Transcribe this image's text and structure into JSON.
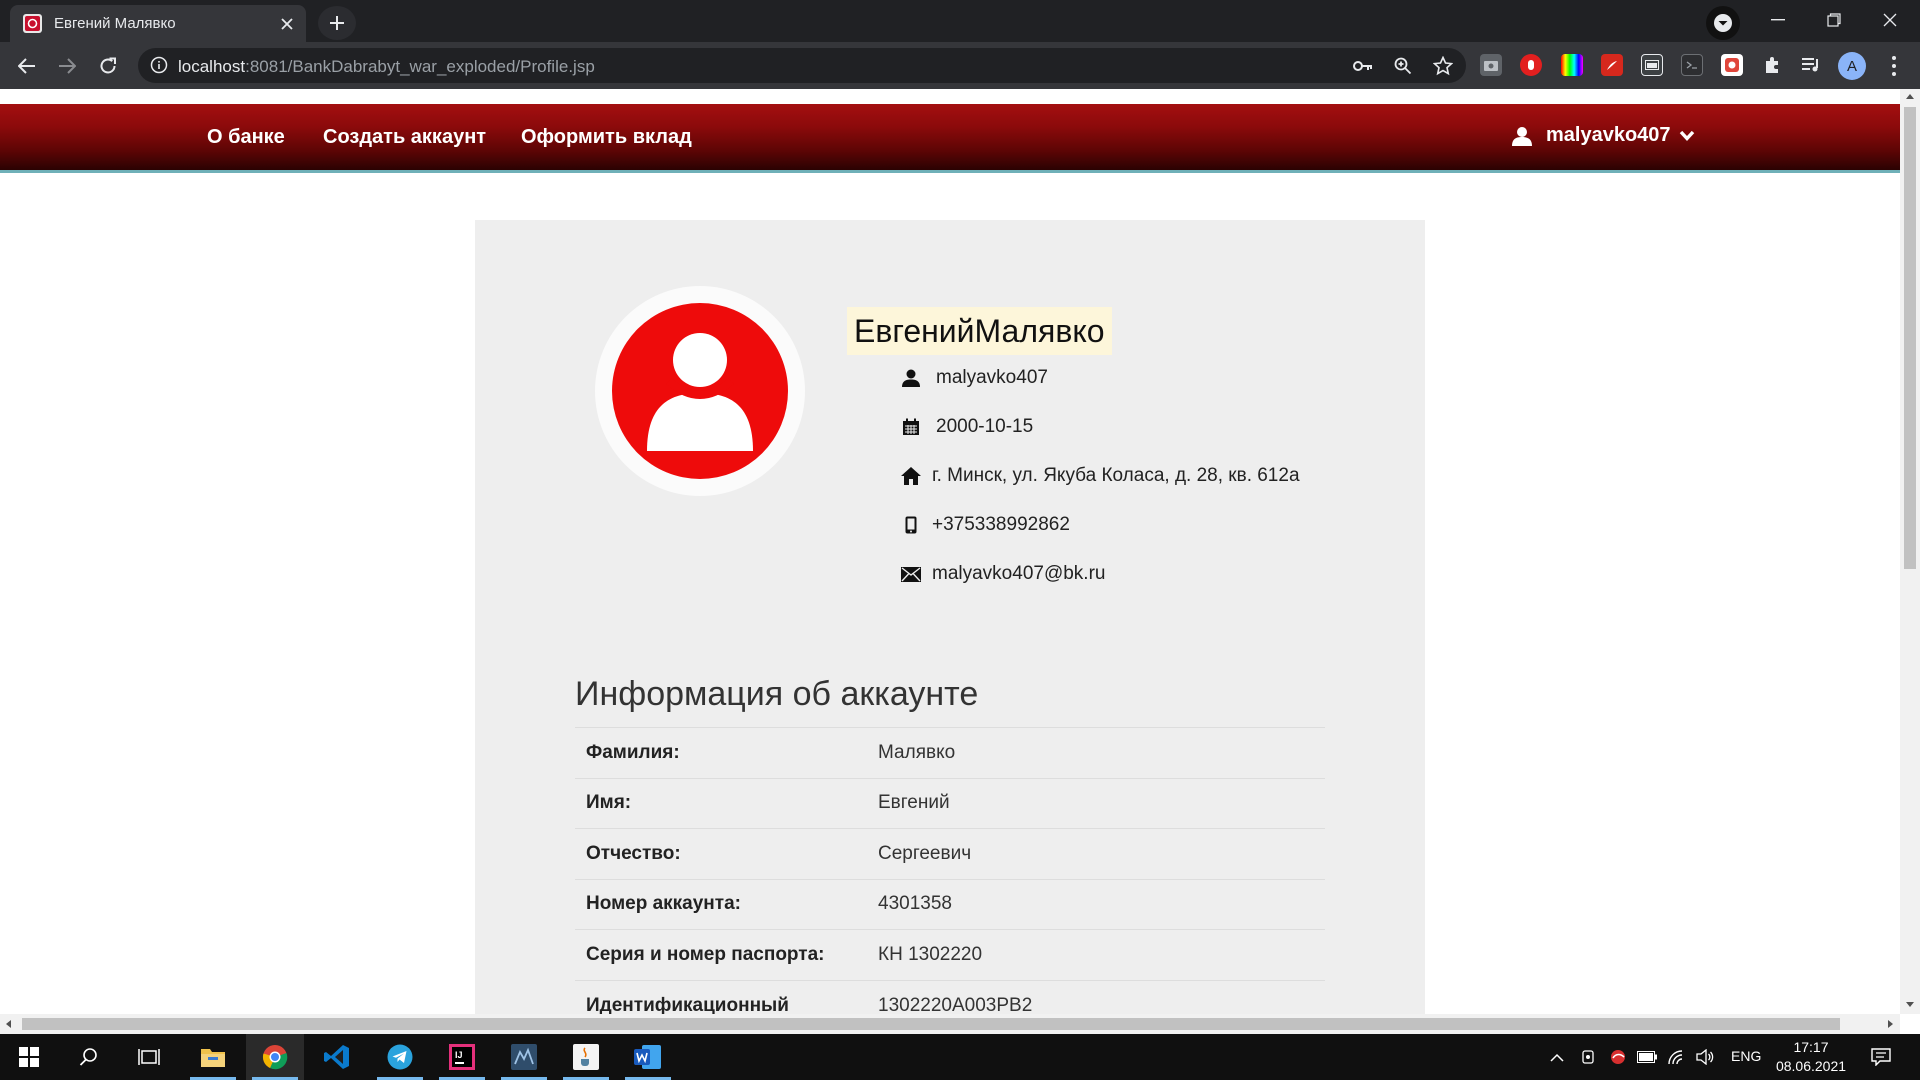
{
  "browser": {
    "tab_title": "Евгений Малявко",
    "url_host": "localhost",
    "url_rest": ":8081/BankDabrabyt_war_exploded/Profile.jsp",
    "avatar_letter": "A"
  },
  "site": {
    "nav": {
      "about": "О банке",
      "create_account": "Создать аккаунт",
      "make_deposit": "Оформить вклад",
      "username": "malyavko407"
    },
    "brand_color": "#8b0a0b"
  },
  "profile": {
    "full_name": "ЕвгенийМалявко",
    "username": "malyavko407",
    "birth_date": "2000-10-15",
    "address": "г. Минск, ул. Якуба Коласа, д. 28, кв. 612a",
    "phone": "+375338992862",
    "email": "malyavko407@bk.ru"
  },
  "account_info": {
    "title": "Информация об аккаунте",
    "rows": [
      {
        "label": "Фамилия:",
        "value": "Малявко"
      },
      {
        "label": "Имя:",
        "value": "Евгений"
      },
      {
        "label": "Отчество:",
        "value": "Сергеевич"
      },
      {
        "label": "Номер аккаунта:",
        "value": "4301358"
      },
      {
        "label": "Серия и номер паспорта:",
        "value": "КН 1302220"
      },
      {
        "label": "Идентификационный",
        "value": "1302220A003PB2"
      }
    ]
  },
  "taskbar": {
    "lang": "ENG",
    "time": "17:17",
    "date": "08.06.2021"
  }
}
